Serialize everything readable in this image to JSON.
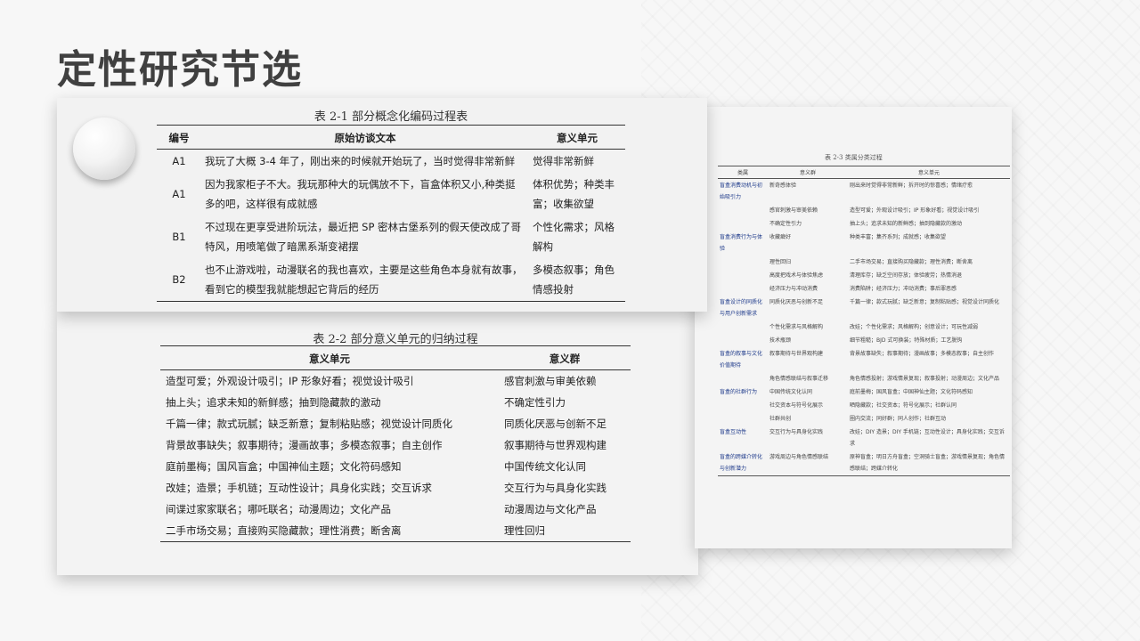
{
  "page": {
    "title": "定性研究节选"
  },
  "table1": {
    "caption": "表 2-1  部分概念化编码过程表",
    "headers": [
      "编号",
      "原始访谈文本",
      "意义单元"
    ],
    "rows": [
      {
        "code": "A1",
        "text": "我玩了大概 3-4 年了，刚出来的时候就开始玩了，当时觉得非常新鲜",
        "meaning": "觉得非常新鲜"
      },
      {
        "code": "A1",
        "text": "因为我家柜子不大。我玩那种大的玩偶放不下，盲盒体积又小,种类挺多的吧，这样很有成就感",
        "meaning": "体积优势；种类丰富；收集欲望"
      },
      {
        "code": "B1",
        "text": "不过现在更享受进阶玩法，最近把 SP 密林古堡系列的假天使改成了哥特风，用喷笔做了暗黑系渐变裙摆",
        "meaning": "个性化需求；风格解构"
      },
      {
        "code": "B2",
        "text": "也不止游戏啦，动漫联名的我也喜欢，主要是这些角色本身就有故事，看到它的模型我就能想起它背后的经历",
        "meaning": "多模态叙事；角色情感投射"
      }
    ]
  },
  "table2": {
    "caption": "表 2-2  部分意义单元的归纳过程",
    "headers": [
      "意义单元",
      "意义群"
    ],
    "rows": [
      [
        "造型可爱；外观设计吸引；IP 形象好看；视觉设计吸引",
        "感官刺激与审美依赖"
      ],
      [
        "抽上头；追求未知的新鲜感；抽到隐藏款的激动",
        "不确定性引力"
      ],
      [
        "千篇一律；款式玩腻；缺乏新意；复制粘贴感；视觉设计同质化",
        "同质化厌恶与创新不足"
      ],
      [
        "背景故事缺失；叙事期待；漫画故事；多模态叙事；自主创作",
        "叙事期待与世界观构建"
      ],
      [
        "庭前墨梅；国风盲盒；中国神仙主题；文化符码感知",
        "中国传统文化认同"
      ],
      [
        "改娃；造景；手机链；互动性设计；具身化实践；交互诉求",
        "交互行为与具身化实践"
      ],
      [
        "间谍过家家联名；哪吒联名；动漫周边；文化产品",
        "动漫周边与文化产品"
      ],
      [
        "二手市场交易；直接购买隐藏款；理性消费；断舍离",
        "理性回归"
      ]
    ]
  },
  "table3": {
    "caption": "表 2-3  类属分类过程",
    "headers": [
      "类属",
      "意义群",
      "意义单元"
    ],
    "rows": [
      [
        "盲盒消费动机与初始吸引力",
        "新奇感体验",
        "刚出来时觉得非常新鲜；拆开时的惊喜感；情绪疗愈"
      ],
      [
        "",
        "感官刺激与审美依赖",
        "造型可爱；外观设计吸引；IP 形象好看；视觉设计吸引"
      ],
      [
        "",
        "不确定性引力",
        "抽上头；追求未知的新鲜感；抽到隐藏款的激动"
      ],
      [
        "盲盒消费行为与体验",
        "收藏癖好",
        "种类丰富；集齐系列；成就感；收集欲望"
      ],
      [
        "",
        "理性回归",
        "二手市场交易；直接购买隐藏款；理性消费；断舍离"
      ],
      [
        "",
        "高度把戏术与体验焦虑",
        "清理库存；缺乏空间存放；体验疲劳；热情消退"
      ],
      [
        "",
        "经济压力与冲动消费",
        "消费陷阱；经济压力；冲动消费；事后罪恶感"
      ],
      [
        "盲盒设计的同质化与用户创新需求",
        "同质化厌恶与创新不足",
        "千篇一律；款式玩腻；缺乏新意；复制粘贴感；视觉设计同质化"
      ],
      [
        "",
        "个性化需求与风格解构",
        "改娃；个性化需求；风格解构；创意设计；可玩性减弱"
      ],
      [
        "",
        "技术瓶颈",
        "细节粗糙；BJD 式可换装；特殊材质；工艺脱钩"
      ],
      [
        "盲盒的叙事与文化价值期待",
        "叙事期待与世界观构建",
        "背景故事缺失；叙事期待；漫画故事；多模态叙事；自主创作"
      ],
      [
        "",
        "角色情感联结与叙事迁移",
        "角色情感投射；游戏情景复现；叙事投射；动漫周边；文化产品"
      ],
      [
        "盲盒的社群行为",
        "中国传统文化认同",
        "庭前墨梅；国风盲盒；中国神仙主题；文化符码感知"
      ],
      [
        "",
        "社交资本与符号化展示",
        "晒隐藏款；社交资本；符号化展示；社群认同"
      ],
      [
        "",
        "社群共创",
        "圈内交流；同好群；同人创作；社群互动"
      ],
      [
        "盲盒互动性",
        "交互行为与具身化实践",
        "改娃；DIY 造景；DIY 手机链；互动性设计；具身化实践；交互诉求"
      ],
      [
        "盲盒的跨媒介转化与创新潜力",
        "游戏周边与角色情感联结",
        "原神盲盒；明日方舟盲盒；空洞骑士盲盒；游戏情景复现；角色情感联结；跨媒介转化"
      ]
    ]
  }
}
